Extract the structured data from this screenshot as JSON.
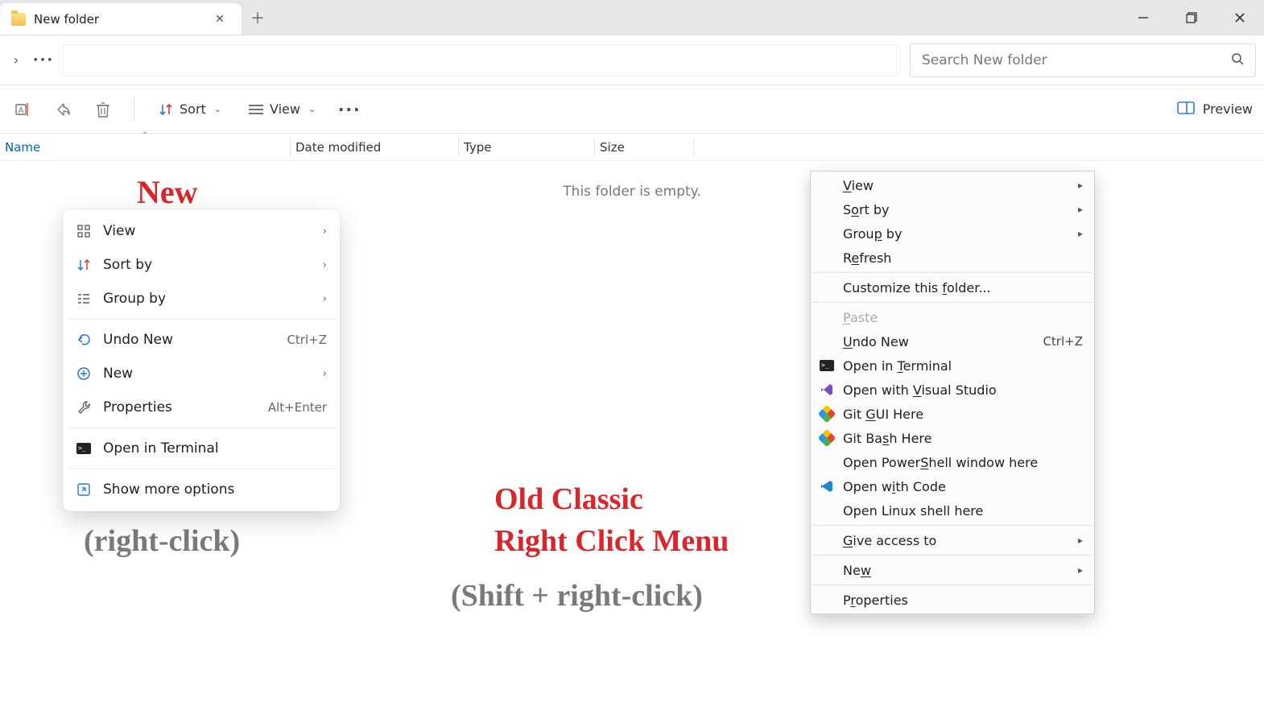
{
  "tab": {
    "title": "New folder"
  },
  "search": {
    "placeholder": "Search New folder"
  },
  "toolbar": {
    "sort_label": "Sort",
    "view_label": "View",
    "preview_label": "Preview"
  },
  "columns": {
    "name": "Name",
    "date_modified": "Date modified",
    "type": "Type",
    "size": "Size"
  },
  "content": {
    "empty_label": "This folder is empty."
  },
  "annotations": {
    "new_label": "New",
    "new_sub": "(right-click)",
    "classic_title1": "Old Classic",
    "classic_title2": "Right Click Menu",
    "classic_sub": "(Shift + right-click)"
  },
  "menu_new": {
    "view": "View",
    "sort_by": "Sort by",
    "group_by": "Group by",
    "undo_new": "Undo New",
    "undo_new_sc": "Ctrl+Z",
    "new": "New",
    "properties": "Properties",
    "properties_sc": "Alt+Enter",
    "open_terminal": "Open in Terminal",
    "show_more": "Show more options"
  },
  "menu_classic": {
    "view": "View",
    "sort_by": "Sort by",
    "group_by": "Group by",
    "refresh": "Refresh",
    "customize": "Customize this folder...",
    "paste": "Paste",
    "undo_new": "Undo New",
    "undo_new_sc": "Ctrl+Z",
    "open_terminal": "Open in Terminal",
    "open_vs": "Open with Visual Studio",
    "git_gui": "Git GUI Here",
    "git_bash": "Git Bash Here",
    "open_ps": "Open PowerShell window here",
    "open_code": "Open with Code",
    "open_linux": "Open Linux shell here",
    "give_access": "Give access to",
    "new": "New",
    "properties": "Properties"
  }
}
